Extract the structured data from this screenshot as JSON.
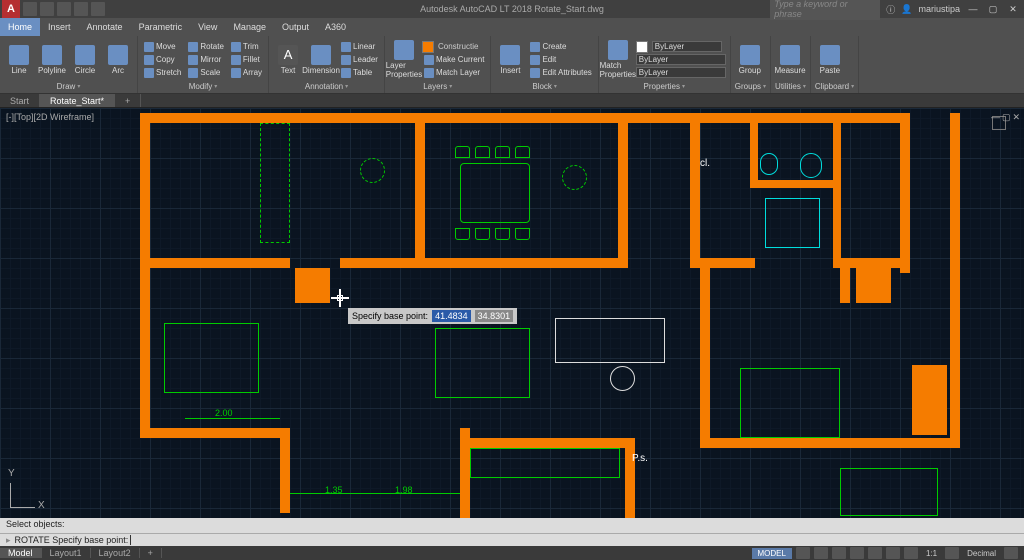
{
  "title": "Autodesk AutoCAD LT 2018   Rotate_Start.dwg",
  "search_placeholder": "Type a keyword or phrase",
  "user": "mariustipa",
  "menu_tabs": [
    "Home",
    "Insert",
    "Annotate",
    "Parametric",
    "View",
    "Manage",
    "Output",
    "A360"
  ],
  "active_menu": 0,
  "ribbon": {
    "draw": {
      "label": "Draw",
      "btns": [
        "Line",
        "Polyline",
        "Circle",
        "Arc"
      ]
    },
    "modify": {
      "label": "Modify",
      "items": [
        "Move",
        "Rotate",
        "Trim",
        "Copy",
        "Mirror",
        "Fillet",
        "Stretch",
        "Scale",
        "Array"
      ]
    },
    "annotation": {
      "label": "Annotation",
      "btns": [
        "Text",
        "Dimension"
      ],
      "items": [
        "Linear",
        "Leader",
        "Table"
      ]
    },
    "layers": {
      "label": "Layers",
      "main": "Layer Properties",
      "items": [
        "Constructie",
        "Make Current",
        "Match Layer"
      ]
    },
    "block": {
      "label": "Block",
      "main": "Insert",
      "items": [
        "Create",
        "Edit",
        "Edit Attributes"
      ]
    },
    "properties": {
      "label": "Properties",
      "main": "Match Properties",
      "lines": [
        "ByLayer",
        "ByLayer",
        "ByLayer"
      ]
    },
    "groups": {
      "label": "Groups",
      "main": "Group"
    },
    "utilities": {
      "label": "Utilities",
      "main": "Measure"
    },
    "clipboard": {
      "label": "Clipboard",
      "main": "Paste"
    }
  },
  "doc_tabs": [
    "Start",
    "Rotate_Start*"
  ],
  "active_doc": 1,
  "viewport_label": "[-][Top][2D Wireframe]",
  "room_labels": {
    "cl": "cl.",
    "ps": "P.s."
  },
  "dimensions": {
    "d1": "2.00",
    "d2": "1.35",
    "d3": "1.98"
  },
  "tooltip": {
    "label": "Specify base point:",
    "v1": "41.4834",
    "v2": "34.8301"
  },
  "ucs": {
    "x": "X",
    "y": "Y"
  },
  "cmd_history": "Select objects:",
  "cmd_prompt": "ROTATE Specify base point:",
  "layout_tabs": [
    "Model",
    "Layout1",
    "Layout2"
  ],
  "active_layout": 0,
  "status": {
    "model": "MODEL",
    "scale": "1:1",
    "units": "Decimal"
  }
}
